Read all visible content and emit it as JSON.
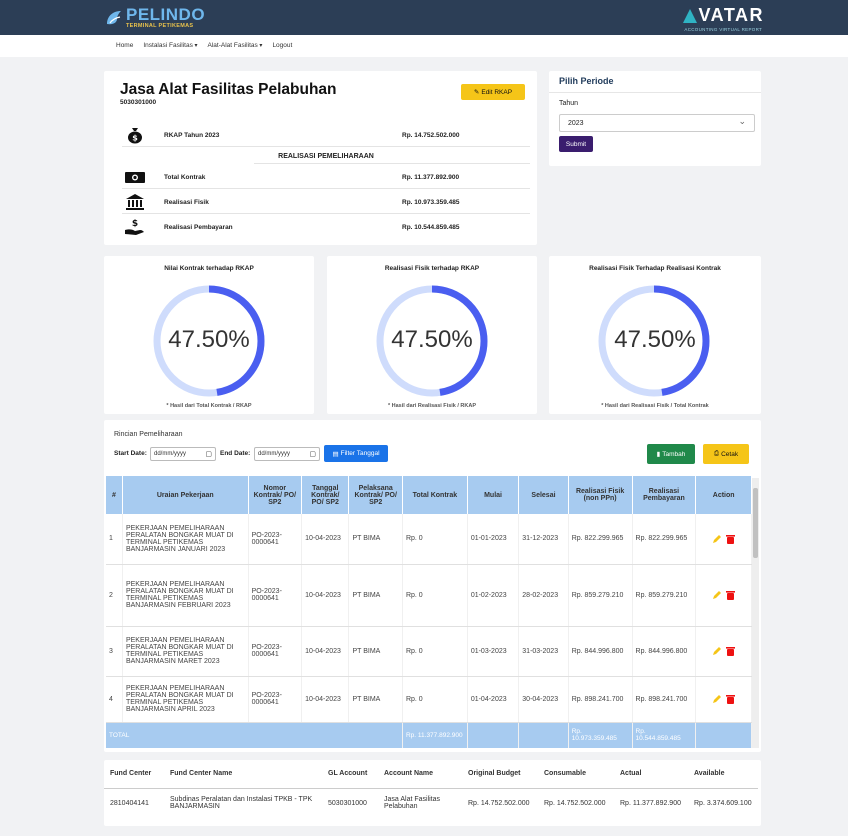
{
  "brand": {
    "left_big": "PELINDO",
    "left_small": "TERMINAL PETIKEMAS",
    "right_big": "VATAR",
    "right_small": "ACCOUNTING VIRTUAL REPORT"
  },
  "nav": {
    "home": "Home",
    "instalasi": "Instalasi Fasilitas",
    "alat": "Alat-Alat Fasilitas",
    "logout": "Logout"
  },
  "summary": {
    "title": "Jasa Alat Fasilitas Pelabuhan",
    "code": "5030301000",
    "edit_label": "Edit RKAP",
    "rkap_label": "RKAP Tahun 2023",
    "rkap_value": "Rp. 14.752.502.000",
    "section": "REALISASI PEMELIHARAAN",
    "kontrak_label": "Total Kontrak",
    "kontrak_value": "Rp. 11.377.892.900",
    "fisik_label": "Realisasi Fisik",
    "fisik_value": "Rp. 10.973.359.485",
    "bayar_label": "Realisasi Pembayaran",
    "bayar_value": "Rp. 10.544.859.485"
  },
  "periode": {
    "title": "Pilih Periode",
    "tahun_label": "Tahun",
    "tahun_value": "2023",
    "submit": "Submit"
  },
  "charts": [
    {
      "title": "Nilai Kontrak terhadap RKAP",
      "percent": "47.50%",
      "value": 47.5,
      "note": "* Hasil dari Total Kontrak / RKAP"
    },
    {
      "title": "Realisasi Fisik terhadap RKAP",
      "percent": "47.50%",
      "value": 47.5,
      "note": "* Hasil dari Realisasi Fisik / RKAP"
    },
    {
      "title": "Realisasi Fisik Terhadap Realisasi Kontrak",
      "percent": "47.50%",
      "value": 47.5,
      "note": "* Hasil dari Realisasi Fisik / Total Kontrak"
    }
  ],
  "colors": {
    "donut_fill": "#4a5ef0",
    "donut_track": "#cfdcfc"
  },
  "rincian": {
    "title": "Rincian Pemeliharaan",
    "start_label": "Start Date:",
    "end_label": "End Date:",
    "date_placeholder": "dd/mm/yyyy",
    "filter": "Filter Tanggal",
    "tambah": "Tambah",
    "cetak": "Cetak",
    "headers": [
      "#",
      "Uraian Pekerjaan",
      "Nomor Kontrak/ PO/ SP2",
      "Tanggal Kontrak/ PO/ SP2",
      "Pelaksana Kontrak/ PO/ SP2",
      "Total Kontrak",
      "Mulai",
      "Selesai",
      "Realisasi Fisik (non PPn)",
      "Realisasi Pembayaran",
      "Action"
    ],
    "rows": [
      {
        "no": "1",
        "uraian": "PEKERJAAN PEMELIHARAAN PERALATAN BONGKAR MUAT DI TERMINAL PETIKEMAS BANJARMASIN JANUARI 2023",
        "nomor": "PO-2023-0000641",
        "tanggal": "10-04-2023",
        "pelaksana": "PT BIMA",
        "total": "Rp. 0",
        "mulai": "01-01-2023",
        "selesai": "31-12-2023",
        "fisik": "Rp. 822.299.965",
        "bayar": "Rp. 822.299.965"
      },
      {
        "no": "2",
        "uraian": "PEKERJAAN PEMELIHARAAN PERALATAN BONGKAR MUAT DI TERMINAL PETIKEMAS BANJARMASIN FEBRUARI 2023",
        "nomor": "PO-2023-0000641",
        "tanggal": "10-04-2023",
        "pelaksana": "PT BIMA",
        "total": "Rp. 0",
        "mulai": "01-02-2023",
        "selesai": "28-02-2023",
        "fisik": "Rp. 859.279.210",
        "bayar": "Rp. 859.279.210"
      },
      {
        "no": "3",
        "uraian": "PEKERJAAN PEMELIHARAAN PERALATAN BONGKAR MUAT DI TERMINAL PETIKEMAS BANJARMASIN MARET 2023",
        "nomor": "PO-2023-0000641",
        "tanggal": "10-04-2023",
        "pelaksana": "PT BIMA",
        "total": "Rp. 0",
        "mulai": "01-03-2023",
        "selesai": "31-03-2023",
        "fisik": "Rp. 844.996.800",
        "bayar": "Rp. 844.996.800"
      },
      {
        "no": "4",
        "uraian": "PEKERJAAN PEMELIHARAAN PERALATAN BONGKAR MUAT DI TERMINAL PETIKEMAS BANJARMASIN APRIL 2023",
        "nomor": "PO-2023-0000641",
        "tanggal": "10-04-2023",
        "pelaksana": "PT BIMA",
        "total": "Rp. 0",
        "mulai": "01-04-2023",
        "selesai": "30-04-2023",
        "fisik": "Rp. 898.241.700",
        "bayar": "Rp. 898.241.700"
      }
    ],
    "total_label": "TOTAL",
    "total_kontrak": "Rp. 11.377.892.900",
    "total_fisik": "Rp. 10.973.359.485",
    "total_bayar": "Rp. 10.544.859.485"
  },
  "fund": {
    "headers": [
      "Fund Center",
      "Fund Center Name",
      "GL Account",
      "Account Name",
      "Original Budget",
      "Consumable",
      "Actual",
      "Available"
    ],
    "row": [
      "2810404141",
      "Subdinas Peralatan dan Instalasi TPKB - TPK BANJARMASIN",
      "5030301000",
      "Jasa Alat Fasilitas Pelabuhan",
      "Rp. 14.752.502.000",
      "Rp. 14.752.502.000",
      "Rp. 11.377.892.900",
      "Rp. 3.374.609.100"
    ]
  }
}
